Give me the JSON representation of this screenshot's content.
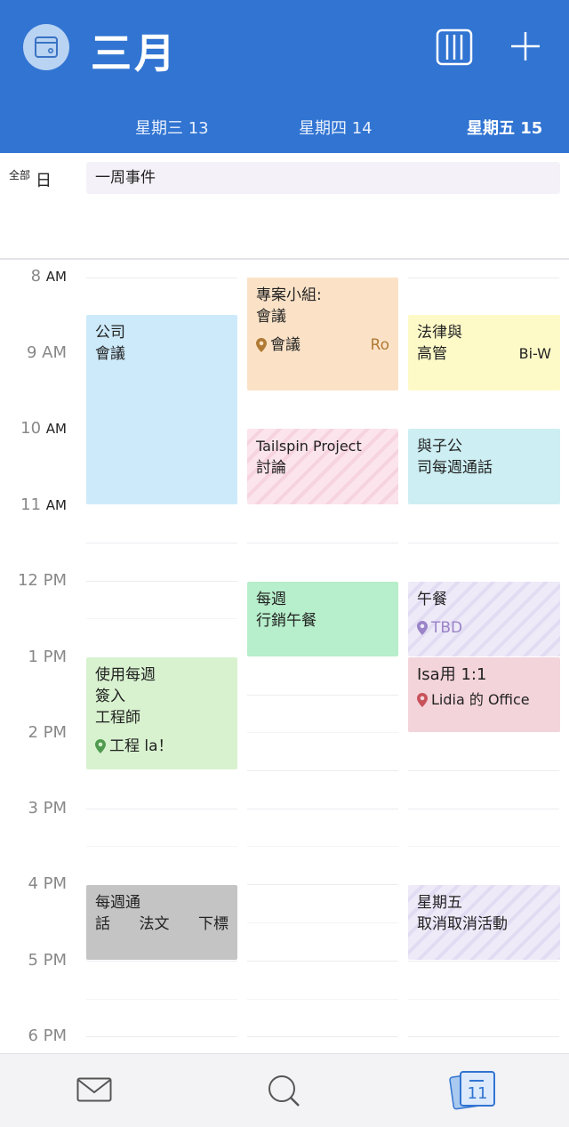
{
  "header": {
    "month": "三月",
    "days": [
      "星期三 13",
      "星期四 14",
      "星期五 15"
    ]
  },
  "allday": {
    "label_top": "全部",
    "label_day": "日",
    "event": "一周事件"
  },
  "hours": [
    {
      "num": "8",
      "ampm": "AM"
    },
    {
      "num": "9 AM",
      "ampm": ""
    },
    {
      "num": "10",
      "ampm": "AM"
    },
    {
      "num": "11",
      "ampm": "AM"
    },
    {
      "num": "12 PM",
      "ampm": ""
    },
    {
      "num": "1 PM",
      "ampm": ""
    },
    {
      "num": "2 PM",
      "ampm": ""
    },
    {
      "num": "3 PM",
      "ampm": ""
    },
    {
      "num": "4 PM",
      "ampm": ""
    },
    {
      "num": "5 PM",
      "ampm": ""
    },
    {
      "num": "6 PM",
      "ampm": ""
    }
  ],
  "events": {
    "company_meeting": {
      "line1": "公司",
      "line2": "會議"
    },
    "project_team": {
      "line1": "專案小組:",
      "line2": "會議",
      "location": "會議",
      "extra": "Ro"
    },
    "legal": {
      "line1": "法律與",
      "line2": "高管",
      "extra": "Bi-W"
    },
    "tailspin": {
      "line1": "Tailspin Project",
      "line2": "討論"
    },
    "subsidiary": {
      "line1": "與子公",
      "line2": "司每週通話"
    },
    "marketing_lunch": {
      "line1": "每週",
      "line2": "行銷午餐"
    },
    "lunch": {
      "line1": "午餐",
      "location": "TBD"
    },
    "checkin": {
      "line1": "使用每週",
      "line2": "簽入",
      "line3": "工程師",
      "location": "工程 la！"
    },
    "one_on_one": {
      "line1": "Isa用 1:1",
      "location": "Lidia 的 Office"
    },
    "weekly_call": {
      "line1": "每週通",
      "line2_a": "話",
      "line2_b": "法文",
      "line2_c": "下標"
    },
    "friday_cancel": {
      "line1": "星期五",
      "line2": "取消取消活動"
    }
  },
  "colors": {
    "header": "#3174d2",
    "blue_event": "#cdeafa",
    "orange_event": "#fbe2c7",
    "yellow_event": "#fefac8",
    "teal_event": "#cdeef2",
    "green_event": "#b7eecb",
    "light_green_event": "#d8f2cf",
    "pink_event": "#f3d4da",
    "gray_event": "#c4c4c4"
  },
  "tabbar": {
    "mail": "mail-icon",
    "search": "search-icon",
    "calendar_day": "11"
  }
}
